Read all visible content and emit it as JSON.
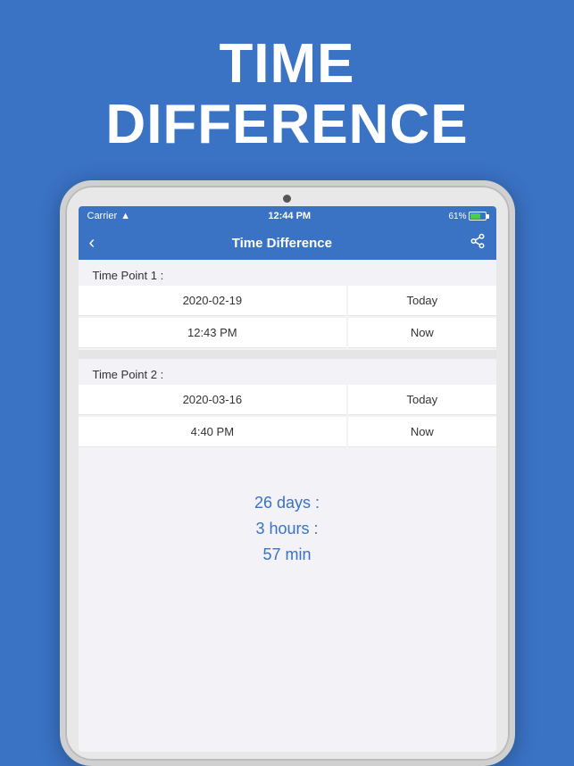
{
  "header": {
    "title": "TIME\nDIFFERENCE",
    "title_line1": "TIME",
    "title_line2": "DIFFERENCE"
  },
  "status_bar": {
    "carrier": "Carrier",
    "time": "12:44 PM",
    "battery": "61%"
  },
  "nav": {
    "back_icon": "‹",
    "title": "Time Difference",
    "share_icon": "⎙"
  },
  "time_point_1": {
    "label": "Time Point 1 :",
    "date_value": "2020-02-19",
    "date_shortcut": "Today",
    "time_value": "12:43 PM",
    "time_shortcut": "Now"
  },
  "time_point_2": {
    "label": "Time Point 2 :",
    "date_value": "2020-03-16",
    "date_shortcut": "Today",
    "time_value": "4:40 PM",
    "time_shortcut": "Now"
  },
  "result": {
    "days": "26 days :",
    "hours": "3 hours :",
    "minutes": "57 min"
  }
}
